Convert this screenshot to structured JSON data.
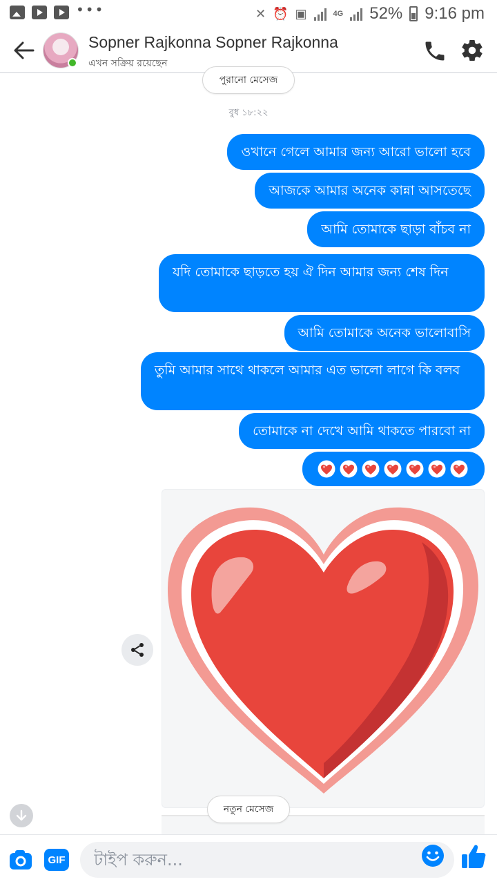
{
  "status_bar": {
    "left_icons": [
      "gallery-icon",
      "youtube-icon",
      "youtube-icon",
      "more-dots-icon"
    ],
    "network": "4G",
    "battery": "52%",
    "time": "9:16 pm"
  },
  "header": {
    "name": "Sopner Rajkonna Sopner Rajkonna",
    "status": "এখন সক্রিয় রয়েছেন",
    "online": true
  },
  "thread": {
    "old_messages_label": "পুরানো মেসেজ",
    "timestamp": "বুধ ১৮:২২",
    "messages": [
      "ওখানে গেলে আমার জন্য আরো ভালো হবে",
      "আজকে আমার অনেক কান্না আসতেছে",
      "আমি তোমাকে ছাড়া বাঁচব না",
      "যদি তোমাকে ছাড়তে হয় ঐ দিন আমার জন্য শেষ দিন",
      "আমি তোমাকে অনেক ভালোবাসি",
      "তুমি আমার সাথে থাকলে আমার এত ভালো লাগে কি বলব",
      "তোমাকে না দেখে আমি থাকতে পারবো না"
    ],
    "emoji_message": [
      "💗",
      "💗",
      "💗",
      "💗",
      "💗",
      "💗",
      "💗"
    ],
    "new_messages_label": "নতুন মেসেজ"
  },
  "composer": {
    "gif_label": "GIF",
    "placeholder": "টাইপ করুন..."
  },
  "colors": {
    "accent": "#0084ff",
    "online": "#42b72a",
    "heart_red": "#e8453c"
  }
}
